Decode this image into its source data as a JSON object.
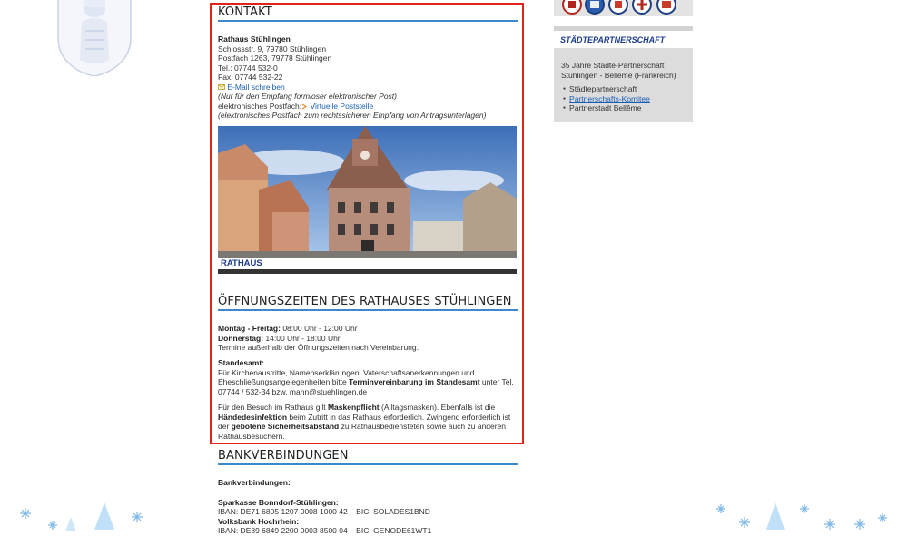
{
  "kontakt": {
    "heading": "KONTAKT",
    "org_name": "Rathaus Stühlingen",
    "address": "Schlossstr. 9, 79780 Stühlingen",
    "postfach": "Postfach 1263, 79778 Stühlingen",
    "tel": "Tel.: 07744 532-0",
    "fax": "Fax: 07744 532-22",
    "email_link": "E-Mail schreiben",
    "email_note": "(Nur für den Empfang formloser elektronischer Post)",
    "epost_label": "elektronisches Postfach:",
    "epost_link": "Virtuelle Poststelle",
    "epost_note": "(elektronisches Postfach zum rechtssicheren Empfang von Antragsunterlagen)",
    "photo_caption": "RATHAUS"
  },
  "oeffnungszeiten": {
    "heading": "ÖFFNUNGSZEITEN DES RATHAUSES STÜHLINGEN",
    "mofr_label": "Montag - Freitag:",
    "mofr_value": " 08:00 Uhr - 12:00 Uhr",
    "do_label": "Donnerstag:",
    "do_value": " 14:00 Uhr - 18:00 Uhr",
    "termine": "Termine außerhalb der Öffnungszeiten nach Vereinbarung.",
    "standesamt_label": "Standesamt:",
    "standesamt_text1": "Für Kirchenaustritte, Namenserklärungen, Vaterschaftsanerkennungen und Eheschließungsangelegenheiten bitte ",
    "standesamt_bold": "Terminvereinbarung im Standesamt",
    "standesamt_text2": " unter Tel. 07744 / 532-34 bzw. mann@stuehlingen.de",
    "corona_text1": "Für den Besuch im Rathaus gilt ",
    "corona_bold1": "Maskenpflicht",
    "corona_text2": " (Alltagsmasken). Ebenfalls ist die ",
    "corona_bold2": "Händedesinfektion",
    "corona_text3": " beim Zutritt in das Rathaus erforderlich. Zwingend erforderlich ist der ",
    "corona_bold3": "gebotene Sicherheitsabstand",
    "corona_text4": " zu Rathausbediensteten sowie auch zu anderen Rathausbesuchern."
  },
  "bank": {
    "heading": "BANKVERBINDUNGEN",
    "label": "Bankverbindungen:",
    "sparkasse_name": "Sparkasse Bonndorf-Stühlingen:",
    "sparkasse_iban": "IBAN: DE71 6805 1207 0008 1000 42    BIC: SOLADES1BND",
    "volksbank_name": "Volksbank Hochrhein:",
    "volksbank_iban": "IBAN: DE89 6849 2200 0003 8500 04    BIC: GENODE61WT1"
  },
  "sidebar": {
    "title": "STÄDTEPARTNERSCHAFT",
    "text": "35 Jahre Städte-Partnerschaft Stühlingen - Bellême (Frankreich)",
    "items": [
      "Städtepartnerschaft",
      "Partnerschafts-Komitee",
      "Partnerstadt Bellême"
    ]
  },
  "colors": {
    "accent_blue": "#3f87cc",
    "frame_red": "#e2231a",
    "link_blue": "#1a5fb4",
    "sidebar_gray": "#dcdcdc"
  },
  "icons": [
    "town-crest-icon",
    "mail-icon",
    "arrow-icon",
    "snowflake-icon",
    "tree-icon",
    "partner-crest-icon"
  ]
}
